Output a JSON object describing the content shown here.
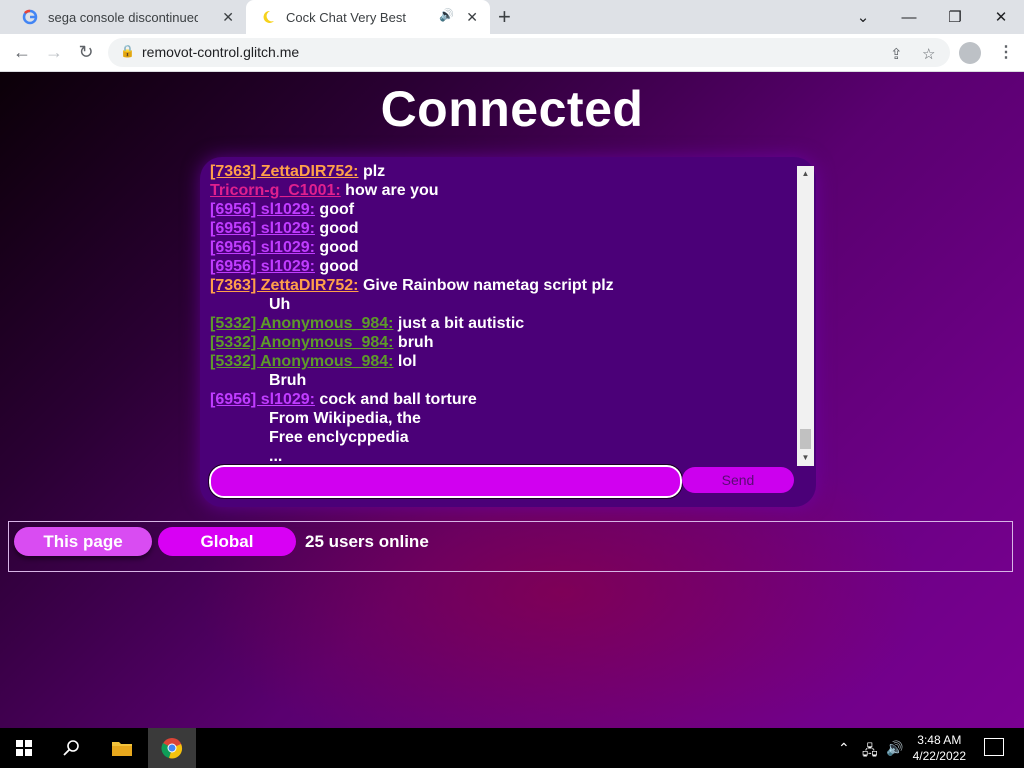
{
  "browser": {
    "tabs": [
      {
        "title": "sega console discontinued - Goo",
        "active": false
      },
      {
        "title": "Cock Chat Very Best",
        "active": true
      }
    ],
    "url": "removot-control.glitch.me"
  },
  "page": {
    "heading": "Connected",
    "messages": [
      {
        "name": "[7363] ZettaDIR752:",
        "text": " plz",
        "color": "#ffa04a"
      },
      {
        "name": "Tricorn-g_C1001:",
        "text": " how are you",
        "color": "#e0208e"
      },
      {
        "name": "[6956] sl1029:",
        "text": " goof",
        "color": "#c03cff"
      },
      {
        "name": "[6956] sl1029:",
        "text": " good",
        "color": "#c03cff"
      },
      {
        "name": "[6956] sl1029:",
        "text": " good",
        "color": "#c03cff"
      },
      {
        "name": "[6956] sl1029:",
        "text": " good",
        "color": "#c03cff"
      },
      {
        "name": "[7363] ZettaDIR752:",
        "text": " Give Rainbow nametag script plz",
        "color": "#ffa04a"
      },
      {
        "name": "",
        "text": "Uh",
        "color": ""
      },
      {
        "name": "[5332] Anonymous_984:",
        "text": " just a bit autistic",
        "color": "#5e9a2a"
      },
      {
        "name": "[5332] Anonymous_984:",
        "text": " bruh",
        "color": "#5e9a2a"
      },
      {
        "name": "[5332] Anonymous_984:",
        "text": " lol",
        "color": "#5e9a2a"
      },
      {
        "name": "",
        "text": "Bruh",
        "color": ""
      },
      {
        "name": "[6956] sl1029:",
        "text": " cock and ball torture",
        "color": "#c03cff"
      },
      {
        "name": "",
        "text": "From Wikipedia, the",
        "color": ""
      },
      {
        "name": "",
        "text": "Free enclycppedia",
        "color": ""
      },
      {
        "name": "",
        "text": "...",
        "color": ""
      }
    ],
    "input_value": "",
    "send_label": "Send",
    "this_page_label": "This page",
    "global_label": "Global",
    "online_text": "25 users online"
  },
  "taskbar": {
    "time": "3:48 AM",
    "date": "4/22/2022"
  }
}
